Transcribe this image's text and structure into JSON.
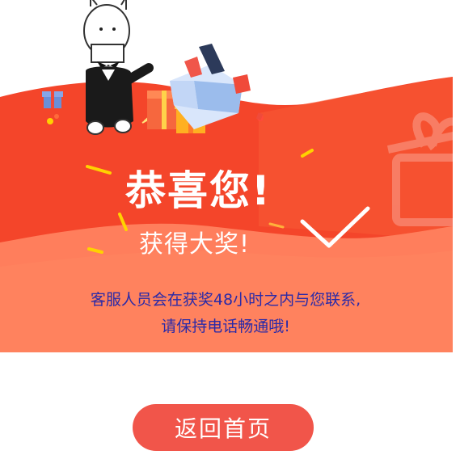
{
  "result": {
    "title": "恭喜您!",
    "subtitle": "获得大奖!",
    "notice_line1": "客服人员会在获奖48小时之内与您联系,",
    "notice_line2": "请保持电话畅通哦!"
  },
  "actions": {
    "home_label": "返回首页"
  },
  "colors": {
    "banner_red": "#f4452a",
    "banner_bottom": "#ff7a55",
    "notice_text": "#2a2aa8",
    "button": "#f1554a"
  },
  "icons": [
    "alpaca-mascot-illustration",
    "gift-box-illustration",
    "checkmark-icon",
    "gift-watermark-icon"
  ]
}
